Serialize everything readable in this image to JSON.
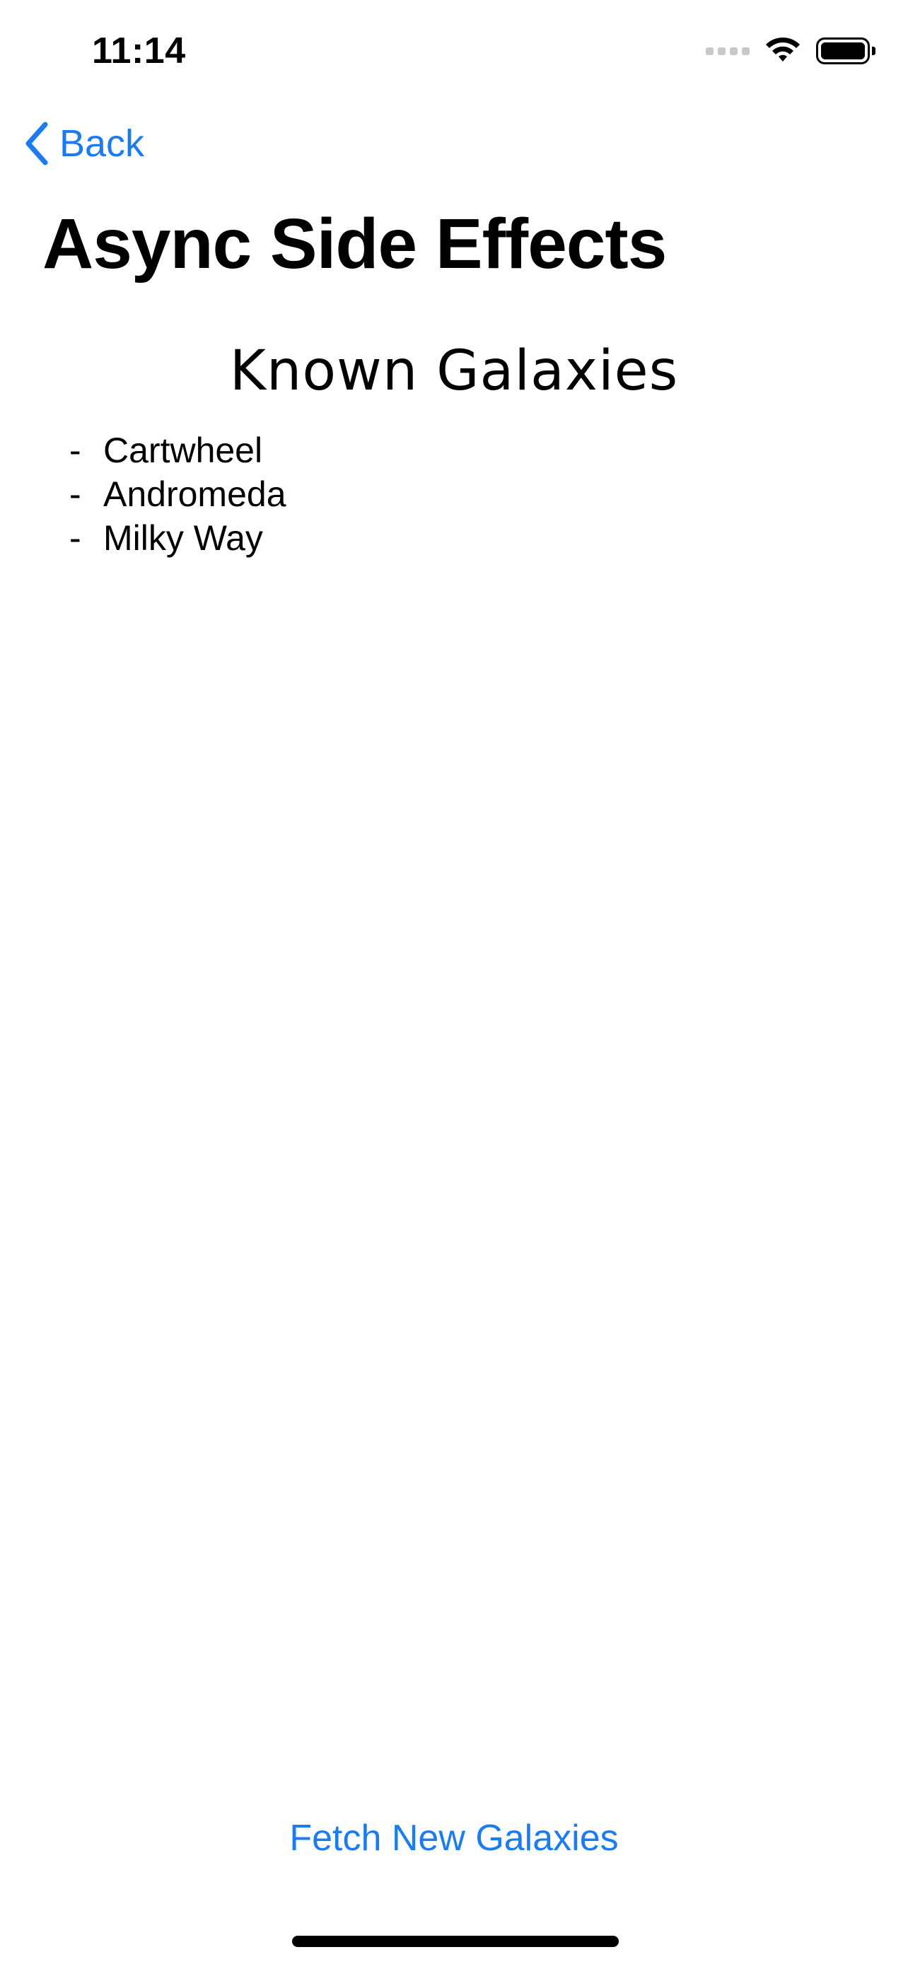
{
  "status_bar": {
    "time": "11:14"
  },
  "nav": {
    "back_label": "Back",
    "title": "Async Side Effects"
  },
  "section": {
    "heading": "Known Galaxies",
    "bullet": "-",
    "items": [
      {
        "label": "Cartwheel"
      },
      {
        "label": "Andromeda"
      },
      {
        "label": "Milky Way"
      }
    ]
  },
  "actions": {
    "fetch_label": "Fetch New Galaxies"
  },
  "colors": {
    "accent": "#1a7cf0",
    "text": "#000000",
    "background": "#ffffff"
  }
}
